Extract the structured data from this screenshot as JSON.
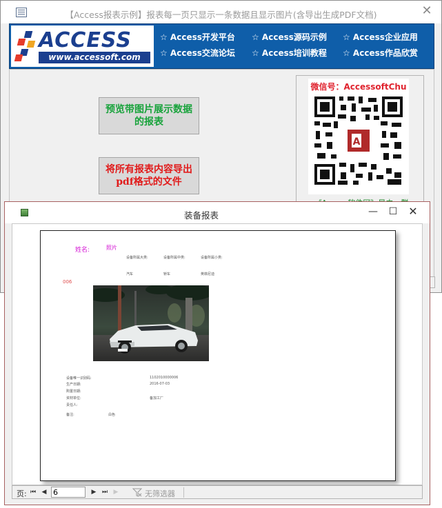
{
  "main_window": {
    "title": "【Access报表示例】报表每一页只显示一条数据且显示图片(含导出生成PDF文档)",
    "close_glyph": "✕"
  },
  "banner": {
    "logo_word": "ACCESS",
    "logo_url": "www.accessoft.com",
    "nav_links": [
      "☆ Access开发平台",
      "☆ Access源码示例",
      "☆ Access企业应用",
      "☆ Access交流论坛",
      "☆ Access培训教程",
      "☆ Access作品欣赏"
    ]
  },
  "buttons": {
    "preview_report": "预览带图片展示数据的报表",
    "export_pdf": "将所有报表内容导出pdf格式的文件"
  },
  "qr_panel": {
    "caption": "微信号：AccessoftChu",
    "footer": "《Access软件网》是由一群"
  },
  "report_window": {
    "title": "装备报表",
    "minimize_glyph": "—",
    "maximize_glyph": "☐",
    "close_glyph": "✕"
  },
  "report_page": {
    "name_label": "姓名:",
    "photo_label": "照片",
    "record_id": "006",
    "category_headers": [
      "设备所属大类:",
      "设备所属中类:",
      "设备所属小类:"
    ],
    "category_values": [
      "汽车",
      "轿车",
      "英菲尼迪"
    ],
    "detail_labels": [
      "设备唯一识别码:",
      "生产日期:",
      "购置日期:",
      "资材单位:",
      "责任人:"
    ],
    "detail_values": [
      "1102010000006",
      "2016-07-03",
      "",
      "备加工厂",
      ""
    ],
    "remark_label": "备注:",
    "remark_value": "白色"
  },
  "nav_bar": {
    "page_label": "页:",
    "first_glyph": "⏮",
    "prev_glyph": "◀",
    "next_glyph": "▶",
    "last_glyph": "⏭",
    "page_number": "6",
    "filter_label": "无筛选器"
  },
  "colors": {
    "banner_blue": "#0f5ea9",
    "preview_button_text": "#19a33c",
    "export_button_text": "#e11b1b",
    "qr_caption": "#e0242f",
    "report_label_magenta": "#d418d4"
  }
}
